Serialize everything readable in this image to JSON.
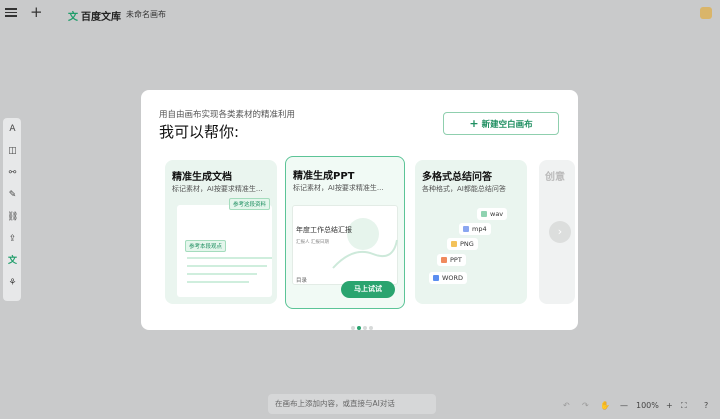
{
  "topbar": {
    "logo_text": "百度文库",
    "logo_mark": "文",
    "doc_title": "未命名画布",
    "plus_glyph": "+"
  },
  "left_toolbar": {
    "icons": [
      "text-icon",
      "shape-icon",
      "connector-icon",
      "pen-icon",
      "link-icon",
      "upload-icon",
      "wenku-icon",
      "apps-icon"
    ],
    "glyphs": [
      "A",
      "◫",
      "⚯",
      "✎",
      "⛓",
      "⇪",
      "文",
      "⚘"
    ]
  },
  "modal": {
    "subtitle": "用自由画布实现各类素材的精准利用",
    "title": "我可以帮你:",
    "new_button": "新建空白画布",
    "new_button_plus": "+",
    "cards": [
      {
        "title": "精准生成文档",
        "desc": "标记素材，AI按要求精准生...",
        "tags": [
          "参考这段资料",
          "参考本段观点"
        ]
      },
      {
        "title": "精准生成PPT",
        "desc": "标记素材，AI按要求精准生...",
        "slide_title": "年度工作总结汇报",
        "slide_small": "汇报人  汇报日期",
        "toc": "目录",
        "button": "马上试试"
      },
      {
        "title": "多格式总结问答",
        "desc": "各种格式，AI都能总结问答",
        "formats": [
          "wav",
          "mp4",
          "PNG",
          "PPT",
          "WORD"
        ]
      },
      {
        "title": "创意"
      }
    ],
    "next_arrow": "›",
    "page_dots": 4,
    "active_dot": 1
  },
  "bottom": {
    "chat_placeholder": "在画布上添加内容，或直接与AI对话",
    "undo": "↶",
    "redo": "↷",
    "hand": "✋",
    "zoom_out": "—",
    "zoom": "100%",
    "zoom_in": "+",
    "fit": "⛶",
    "help": "?"
  },
  "colors": {
    "accent": "#2aa46f",
    "background": "#c9cacb"
  }
}
